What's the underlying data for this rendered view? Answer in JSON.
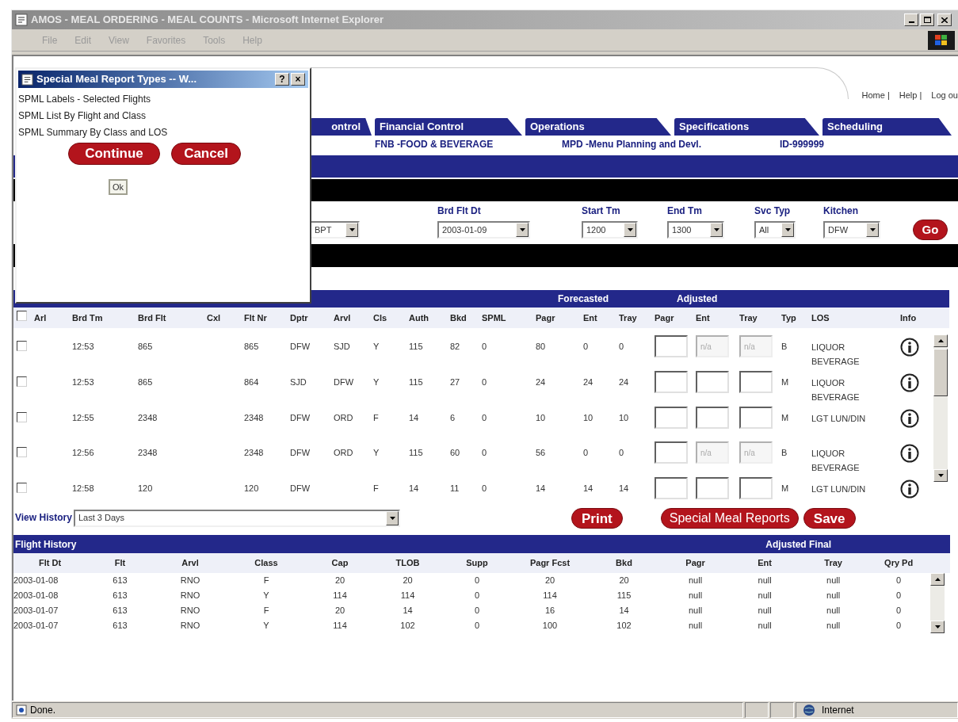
{
  "window": {
    "title": "AMOS - MEAL ORDERING - MEAL COUNTS - Microsoft Internet Explorer"
  },
  "menu": [
    "File",
    "Edit",
    "View",
    "Favorites",
    "Tools",
    "Help"
  ],
  "header_links": [
    "Home |",
    "Help |",
    "Log ou"
  ],
  "tabs": [
    {
      "label": "ontrol"
    },
    {
      "label": "Financial Control"
    },
    {
      "label": "Operations"
    },
    {
      "label": "Specifications"
    },
    {
      "label": "Scheduling"
    }
  ],
  "info_line": [
    "FNB -FOOD & BEVERAGE",
    "MPD -Menu Planning and Devl.",
    "ID-999999"
  ],
  "filters": [
    {
      "value": "BPT"
    },
    {
      "label": "Brd Flt Dt",
      "value": "2003-01-09"
    },
    {
      "label": "Start Tm",
      "value": "1200"
    },
    {
      "label": "End Tm",
      "value": "1300"
    },
    {
      "label": "Svc Typ",
      "value": "All"
    },
    {
      "label": "Kitchen",
      "value": "DFW"
    }
  ],
  "go_button": "Go",
  "flights_table": {
    "group_headers": [
      "Forecasted",
      "Adjusted"
    ],
    "header_checkbox": {
      "checked": false
    },
    "columns": [
      "Arl",
      "Brd Tm",
      "Brd Flt",
      "Cxl",
      "Flt Nr",
      "Dptr",
      "Arvl",
      "Cls",
      "Auth",
      "Bkd",
      "SPML",
      "Pagr",
      "Ent",
      "Tray",
      "Pagr",
      "Ent",
      "Tray",
      "Typ",
      "LOS",
      "Info"
    ],
    "rows": [
      {
        "checked": false,
        "cells": [
          "",
          "12:53",
          "865",
          "",
          "865",
          "DFW",
          "SJD",
          "Y",
          "115",
          "82",
          "0",
          "80",
          "0",
          "0"
        ],
        "adjusted": [
          {
            "disabled": false
          },
          {
            "value": "n/a",
            "disabled": true
          },
          {
            "value": "n/a",
            "disabled": true
          }
        ],
        "typ": "B",
        "los": "LIQUOR BEVERAGE"
      },
      {
        "checked": false,
        "cells": [
          "",
          "12:53",
          "865",
          "",
          "864",
          "SJD",
          "DFW",
          "Y",
          "115",
          "27",
          "0",
          "24",
          "24",
          "24"
        ],
        "adjusted": [
          {
            "disabled": false
          },
          {
            "disabled": false
          },
          {
            "disabled": false
          }
        ],
        "typ": "M",
        "los": "LIQUOR BEVERAGE"
      },
      {
        "checked": false,
        "cells": [
          "",
          "12:55",
          "2348",
          "",
          "2348",
          "DFW",
          "ORD",
          "F",
          "14",
          "6",
          "0",
          "10",
          "10",
          "10"
        ],
        "adjusted": [
          {
            "disabled": false
          },
          {
            "disabled": false
          },
          {
            "disabled": false
          }
        ],
        "typ": "M",
        "los": "LGT LUN/DIN"
      },
      {
        "checked": false,
        "cells": [
          "",
          "12:56",
          "2348",
          "",
          "2348",
          "DFW",
          "ORD",
          "Y",
          "115",
          "60",
          "0",
          "56",
          "0",
          "0"
        ],
        "adjusted": [
          {
            "disabled": false
          },
          {
            "value": "n/a",
            "disabled": true
          },
          {
            "value": "n/a",
            "disabled": true
          }
        ],
        "typ": "B",
        "los": "LIQUOR BEVERAGE"
      },
      {
        "checked": false,
        "cells": [
          "",
          "12:58",
          "120",
          "",
          "120",
          "DFW",
          "",
          "F",
          "14",
          "11",
          "0",
          "14",
          "14",
          "14"
        ],
        "adjusted": [
          {
            "disabled": false
          },
          {
            "disabled": false
          },
          {
            "disabled": false
          }
        ],
        "typ": "M",
        "los": "LGT LUN/DIN"
      }
    ]
  },
  "view_history": {
    "label": "View History",
    "value": "Last 3 Days"
  },
  "buttons": [
    "Print",
    "Special Meal Reports",
    "Save"
  ],
  "flight_history": {
    "title": "Flight History",
    "group_header": "Adjusted Final",
    "columns": [
      "Flt Dt",
      "Flt",
      "Arvl",
      "Class",
      "Cap",
      "TLOB",
      "Supp",
      "Pagr Fcst",
      "Bkd",
      "Pagr",
      "Ent",
      "Tray",
      "Qry Pd"
    ],
    "rows": [
      [
        "2003-01-08",
        "613",
        "RNO",
        "F",
        "20",
        "20",
        "0",
        "20",
        "20",
        "null",
        "null",
        "null",
        "0"
      ],
      [
        "2003-01-08",
        "613",
        "RNO",
        "Y",
        "114",
        "114",
        "0",
        "114",
        "115",
        "null",
        "null",
        "null",
        "0"
      ],
      [
        "2003-01-07",
        "613",
        "RNO",
        "F",
        "20",
        "14",
        "0",
        "16",
        "14",
        "null",
        "null",
        "null",
        "0"
      ],
      [
        "2003-01-07",
        "613",
        "RNO",
        "Y",
        "114",
        "102",
        "0",
        "100",
        "102",
        "null",
        "null",
        "null",
        "0"
      ]
    ]
  },
  "status_bar": {
    "text": "Done.",
    "zone": "Internet"
  },
  "dialog": {
    "title": "Special Meal Report Types -- W...",
    "title_buttons": [
      "?",
      "×"
    ],
    "items": [
      "SPML Labels - Selected Flights",
      "SPML List By Flight and Class",
      "SPML Summary By Class and LOS"
    ],
    "buttons": [
      "Continue",
      "Cancel"
    ],
    "ok": "Ok"
  }
}
